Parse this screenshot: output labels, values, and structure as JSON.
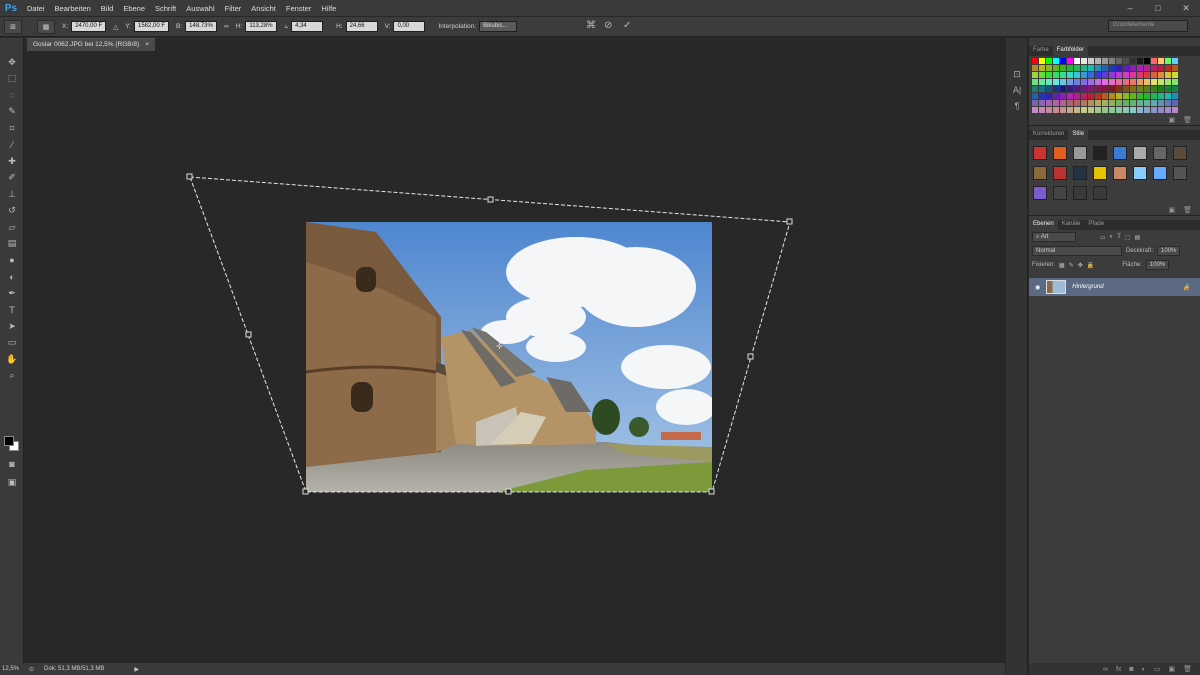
{
  "app": {
    "logo": "Ps"
  },
  "menu": [
    "Datei",
    "Bearbeiten",
    "Bild",
    "Ebene",
    "Schrift",
    "Auswahl",
    "Filter",
    "Ansicht",
    "Fenster",
    "Hilfe"
  ],
  "window_controls": [
    "–",
    "□",
    "✕"
  ],
  "options": {
    "x_label": "X:",
    "x_value": "2470,00 F",
    "y_label": "Y:",
    "y_value": "1582,00 F",
    "b_label": "B:",
    "b_value": "148,73%",
    "h_label": "H:",
    "h_value": "113,28%",
    "angle_value": "4,34",
    "hskew_label": "H:",
    "hskew_value": "24,66",
    "vskew_label": "V:",
    "vskew_value": "0,00",
    "interp_label": "Interpolation:",
    "interp_value": "Bikubis...",
    "workspace": "Grundelemente"
  },
  "document": {
    "tab_title": "Goslar 0062.JPG bei 12,5% (RGB/8)",
    "close": "×"
  },
  "status": {
    "zoom": "12,5%",
    "doc_info": "Dok: 51,3 MB/51,3 MB"
  },
  "panels": {
    "swatches_tabs": [
      "Farbe",
      "Farbfelder"
    ],
    "adjust_tabs": [
      "Korrekturen",
      "Stile"
    ],
    "layers_tabs": [
      "Ebenen",
      "Kanäle",
      "Pfade"
    ],
    "filter_kind": "Art",
    "blend_mode": "Normal",
    "opacity_label": "Deckkraft:",
    "opacity_value": "100%",
    "lock_label": "Fixieren:",
    "fill_label": "Fläche:",
    "fill_value": "100%",
    "layer_name": "Hintergrund"
  }
}
